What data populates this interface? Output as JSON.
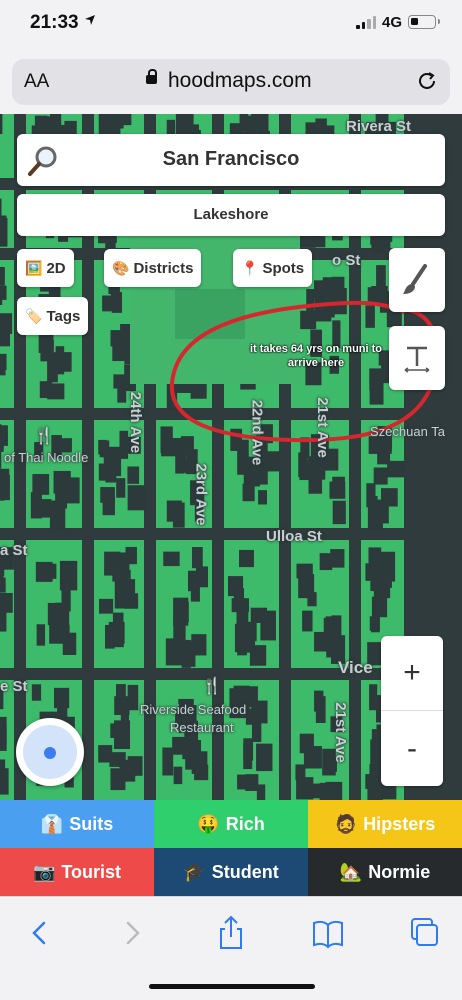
{
  "status_bar": {
    "time": "21:33",
    "network": "4G"
  },
  "browser": {
    "text_size_label": "AA",
    "domain": "hoodmaps.com"
  },
  "map": {
    "city": "San Francisco",
    "neighborhood": "Lakeshore",
    "buttons": {
      "view_2d": "2D",
      "districts": "Districts",
      "spots": "Spots",
      "tags": "Tags"
    },
    "zoom_in": "+",
    "zoom_out": "-",
    "annotation": "it takes 64 yrs on muni to arrive here",
    "streets": {
      "top": "Rivera St",
      "upper_right": "o St",
      "ave_24": "24th Ave",
      "ave_23": "23rd Ave",
      "ave_22": "22nd Ave",
      "ave_21_top": "21st Ave",
      "ave_21_bottom": "21st Ave",
      "ulloa": "Ulloa St",
      "vice": "Vice",
      "left_st_1": "a St",
      "left_st_2": "e St"
    },
    "pois": {
      "szechuan": "Szechuan Ta",
      "thai": "of Thai Noodle",
      "riverside_1": "Riverside Seafood",
      "riverside_2": "Restaurant"
    }
  },
  "categories": [
    {
      "label": "Suits",
      "emoji": "👔",
      "color": "#4a9ff0"
    },
    {
      "label": "Rich",
      "emoji": "🤑",
      "color": "#2fcf6e"
    },
    {
      "label": "Hipsters",
      "emoji": "🧔",
      "color": "#f5c518"
    },
    {
      "label": "Tourist",
      "emoji": "📷",
      "color": "#ef4a4a"
    },
    {
      "label": "Student",
      "emoji": "🎓",
      "color": "#1d4a74"
    },
    {
      "label": "Normie",
      "emoji": "🏡",
      "color": "#262a2d"
    }
  ],
  "toolbar_icons": [
    "back-icon",
    "forward-icon",
    "share-icon",
    "bookmarks-icon",
    "tabs-icon"
  ]
}
